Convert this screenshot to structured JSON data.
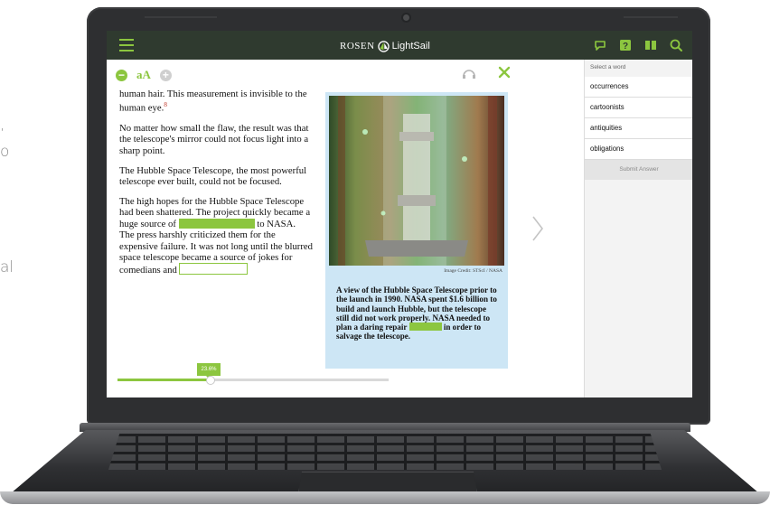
{
  "background_fragments": [
    ",",
    "o",
    "al"
  ],
  "app": {
    "brand_left": "ROSEN",
    "brand_right": "LightSail",
    "accent_color": "#8cc63f",
    "topbar_color": "#2f3a2f",
    "top_icons": [
      "chat-icon",
      "help-icon",
      "book-icon",
      "search-icon"
    ]
  },
  "toolbar": {
    "decrease_label": "−",
    "font_label": "aA",
    "increase_label": "+"
  },
  "reading": {
    "p1_text": "human hair. This measurement is invisible to the human eye.",
    "p1_footnote": "8",
    "p2": "No matter how small the flaw, the result was that the telescope's mirror could not focus light into a sharp point.",
    "p3": "The Hubble Space Telescope, the most powerful telescope ever built, could not be focused.",
    "p4_a": "The high hopes for the Hubble Space Telescope had been shattered. The project quickly became a huge source of",
    "p4_b": "to NASA. The press harshly criticized them for the expensive failure. It was not long until the blurred space telescope became a source of jokes for comedians and"
  },
  "figure": {
    "credit": "Image Credit: STScI / NASA",
    "caption_a": "A view of the Hubble Space Telescope prior to the launch in 1990. NASA spent $1.6 billion to build and launch Hubble, but the telescope still did not work properly. NASA needed to plan a daring repair",
    "caption_b": "in order to salvage the telescope."
  },
  "progress": {
    "label": "23.6%",
    "fraction": 0.236
  },
  "sidebar": {
    "prompt": "Select a word",
    "options": [
      "occurrences",
      "cartoonists",
      "antiquities",
      "obligations"
    ],
    "submit_label": "Submit Answer"
  }
}
